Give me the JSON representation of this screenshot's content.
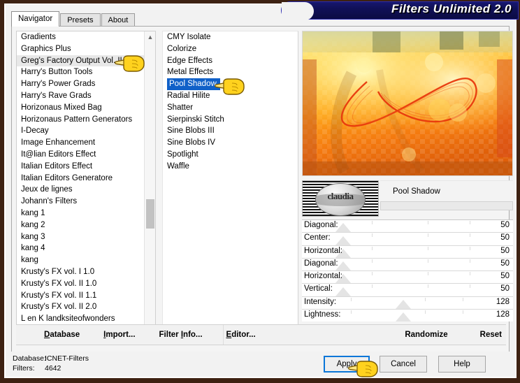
{
  "window": {
    "title": "Filters Unlimited 2.0",
    "border_color": "#3d2112",
    "banner_color": "#101057"
  },
  "tabs": [
    {
      "label": "Navigator",
      "active": true
    },
    {
      "label": "Presets",
      "active": false
    },
    {
      "label": "About",
      "active": false
    }
  ],
  "filter_list": {
    "selected": "Greg's Factory Output Vol. II",
    "items": [
      "Gradients",
      "Graphics Plus",
      "Greg's Factory Output Vol. II",
      "Harry's Button Tools",
      "Harry's Power Grads",
      "Harry's Rave Grads",
      "Horizonaus Mixed Bag",
      "Horizonaus Pattern Generators",
      "I-Decay",
      "Image Enhancement",
      "It@lian Editors Effect",
      "Italian Editors Effect",
      "Italian Editors Generatore",
      "Jeux de lignes",
      "Johann's Filters",
      "kang 1",
      "kang 2",
      "kang 3",
      "kang 4",
      "kang",
      "Krusty's FX vol. I 1.0",
      "Krusty's FX vol. II 1.0",
      "Krusty's FX vol. II 1.1",
      "Krusty's FX vol. II 2.0",
      "L en K landksiteofwonders"
    ]
  },
  "effect_list": {
    "selected": "Pool Shadow",
    "items": [
      "CMY Isolate",
      "Colorize",
      "Edge Effects",
      "Metal Effects",
      "Pool Shadow",
      "Radial Hilite",
      "Shatter",
      "Sierpinski Stitch",
      "Sine Blobs III",
      "Sine Blobs IV",
      "Spotlight",
      "Waffle"
    ]
  },
  "preview": {
    "effect_name": "Pool Shadow",
    "watermark": "claudia"
  },
  "parameters": [
    {
      "label": "Diagonal:",
      "value": "50",
      "percent": 20
    },
    {
      "label": "Center:",
      "value": "50",
      "percent": 20
    },
    {
      "label": "Horizontal:",
      "value": "50",
      "percent": 20
    },
    {
      "label": "Diagonal:",
      "value": "50",
      "percent": 20
    },
    {
      "label": "Horizontal:",
      "value": "50",
      "percent": 20
    },
    {
      "label": "Vertical:",
      "value": "50",
      "percent": 20
    },
    {
      "label": "Intensity:",
      "value": "128",
      "percent": 50
    },
    {
      "label": "Lightness:",
      "value": "128",
      "percent": 50
    }
  ],
  "menu": {
    "left": [
      {
        "accel": "D",
        "rest": "atabase"
      },
      {
        "accel": "I",
        "rest": "mport..."
      },
      {
        "pre": "Filter ",
        "accel": "I",
        "rest": "nfo..."
      },
      {
        "accel": "E",
        "rest": "ditor..."
      }
    ],
    "right": [
      {
        "label": "Randomize"
      },
      {
        "label": "Reset"
      }
    ]
  },
  "status": {
    "database_key": "Database:",
    "database_value": "ICNET-Filters",
    "filters_key": "Filters:",
    "filters_value": "4642"
  },
  "buttons": {
    "apply": "Apply",
    "cancel": "Cancel",
    "help": "Help"
  }
}
